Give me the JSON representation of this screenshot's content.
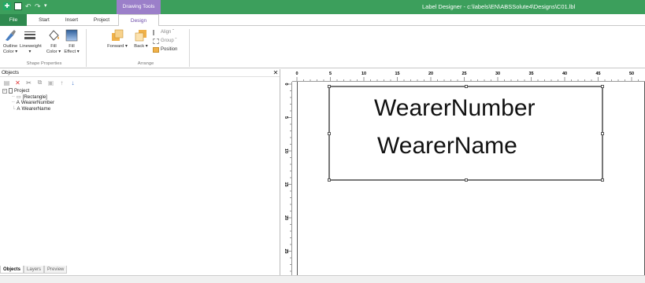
{
  "window": {
    "title": "Label Designer - c:\\labels\\EN\\ABSSolute4\\Designs\\C01.lbl",
    "context_tab_header": "Drawing Tools"
  },
  "tabs": {
    "file": "File",
    "start": "Start",
    "insert": "Insert",
    "project": "Project",
    "design": "Design"
  },
  "ribbon": {
    "outline_color": "Outline Color ▾",
    "lineweight": "Lineweight ▾",
    "fill_color": "Fill Color ▾",
    "fill_effect": "Fill Effect ▾",
    "shape_properties": "Shape Properties",
    "forward": "Forward ▾",
    "back": "Back ▾",
    "align": "Align ˇ",
    "group": "Group ˇ",
    "position": "Position",
    "arrange": "Arrange"
  },
  "objects_panel": {
    "title": "Objects",
    "close": "✕",
    "tree": {
      "root": "Project",
      "items": [
        "[Rectangle]",
        "WearerNumber",
        "WearerName"
      ],
      "item_glyphs": [
        "▭",
        "A",
        "A"
      ]
    },
    "bottom_tabs": [
      "Objects",
      "Layers",
      "Preview"
    ]
  },
  "design": {
    "field_1": "WearerNumber",
    "field_2": "WearerName"
  },
  "ruler_top": [
    "0",
    "5",
    "10",
    "15",
    "20",
    "25",
    "30",
    "35",
    "40",
    "45",
    "50"
  ],
  "ruler_left": [
    "0",
    "5",
    "10",
    "15",
    "20",
    "25"
  ],
  "colors": {
    "titlebar": "#3c9f5c",
    "file_tab": "#2f8a4f",
    "context_tab": "#9b7fc9"
  }
}
